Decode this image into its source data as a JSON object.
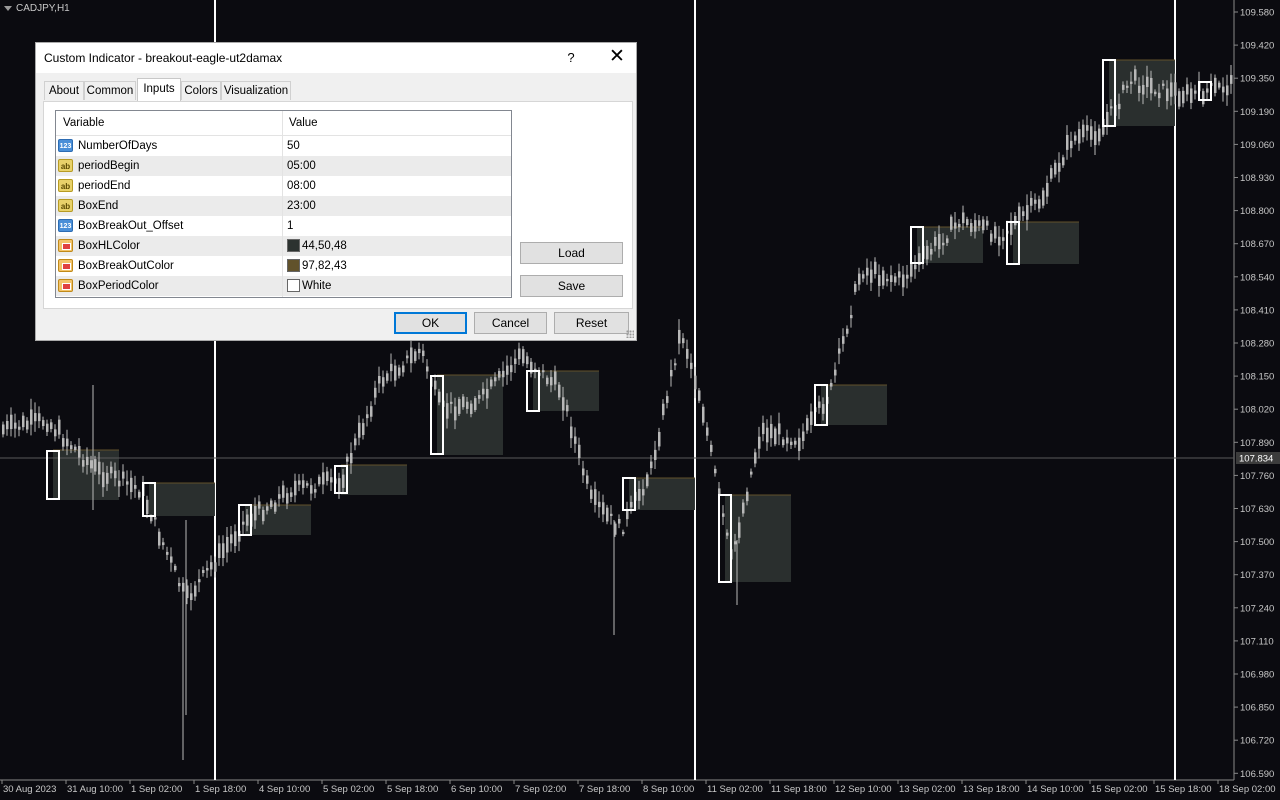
{
  "chart": {
    "symbol": "CADJPY,H1",
    "current_price": "107.834",
    "price_labels": [
      "109.580",
      "109.420",
      "109.350",
      "109.190",
      "109.060",
      "108.930",
      "108.800",
      "108.670",
      "108.540",
      "108.410",
      "108.280",
      "108.150",
      "108.020",
      "107.890",
      "107.760",
      "107.630",
      "107.500",
      "107.370",
      "107.240",
      "107.110",
      "106.980",
      "106.850",
      "106.720",
      "106.590"
    ],
    "time_labels": [
      "30 Aug 2023",
      "31 Aug 10:00",
      "1 Sep 02:00",
      "1 Sep 18:00",
      "4 Sep 10:00",
      "5 Sep 02:00",
      "5 Sep 18:00",
      "6 Sep 10:00",
      "7 Sep 02:00",
      "7 Sep 18:00",
      "8 Sep 10:00",
      "11 Sep 02:00",
      "11 Sep 18:00",
      "12 Sep 10:00",
      "13 Sep 02:00",
      "13 Sep 18:00",
      "14 Sep 10:00",
      "15 Sep 02:00",
      "15 Sep 18:00",
      "18 Sep 02:00"
    ],
    "colors": {
      "background": "#0b0b10",
      "candle": "#b8b8b8",
      "box_hl": "#2c3230",
      "box_breakout": "#61522b",
      "box_period": "#ffffff",
      "separator": "#ffffff",
      "bid_line": "#5a5a5a",
      "bid_label_bg": "#3c3c3c"
    }
  },
  "dialog": {
    "title": "Custom Indicator - breakout-eagle-ut2damax",
    "help_label": "?",
    "close_label": "✕",
    "tabs": [
      {
        "label": "About"
      },
      {
        "label": "Common"
      },
      {
        "label": "Inputs"
      },
      {
        "label": "Colors"
      },
      {
        "label": "Visualization"
      }
    ],
    "active_tab": "Inputs",
    "columns": {
      "variable": "Variable",
      "value": "Value"
    },
    "inputs": [
      {
        "name": "NumberOfDays",
        "value": "50",
        "type": "number",
        "icon": "integer-icon"
      },
      {
        "name": "periodBegin",
        "value": "05:00",
        "type": "string",
        "icon": "string-icon"
      },
      {
        "name": "periodEnd",
        "value": "08:00",
        "type": "string",
        "icon": "string-icon"
      },
      {
        "name": "BoxEnd",
        "value": "23:00",
        "type": "string",
        "icon": "string-icon"
      },
      {
        "name": "BoxBreakOut_Offset",
        "value": "1",
        "type": "number",
        "icon": "integer-icon"
      },
      {
        "name": "BoxHLColor",
        "value": "44,50,48",
        "type": "color",
        "color": "#2c3230",
        "icon": "color-icon"
      },
      {
        "name": "BoxBreakOutColor",
        "value": "97,82,43",
        "type": "color",
        "color": "#61522b",
        "icon": "color-icon"
      },
      {
        "name": "BoxPeriodColor",
        "value": "White",
        "type": "color",
        "color": "#ffffff",
        "icon": "color-icon"
      }
    ],
    "icon_text": {
      "number": "123",
      "string": "ab"
    },
    "buttons": {
      "load": "Load",
      "save": "Save",
      "ok": "OK",
      "cancel": "Cancel",
      "reset": "Reset"
    }
  }
}
